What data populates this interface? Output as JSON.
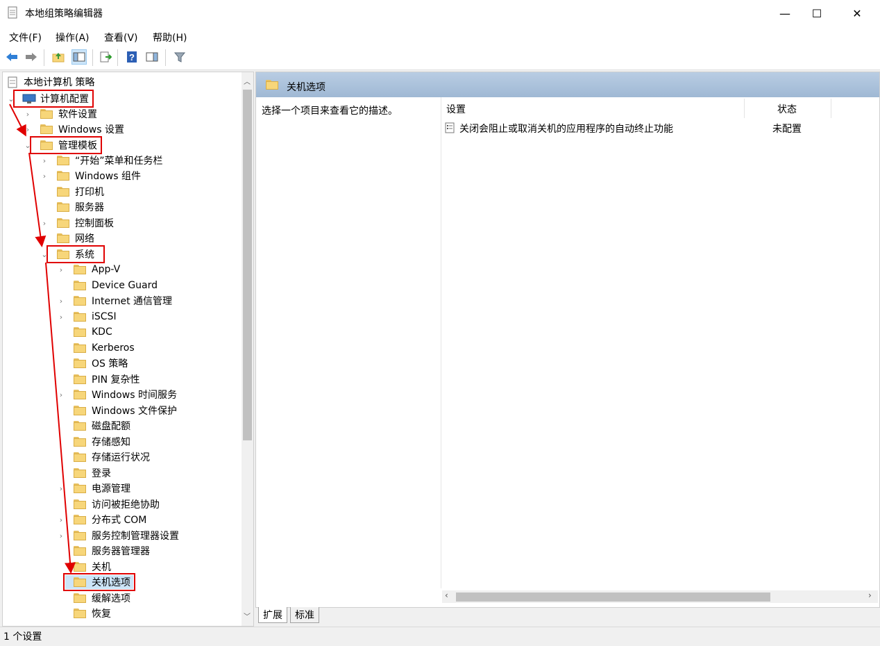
{
  "window": {
    "title": "本地组策略编辑器",
    "minimize": "—",
    "maximize": "☐",
    "close": "✕"
  },
  "menu": [
    "文件(F)",
    "操作(A)",
    "查看(V)",
    "帮助(H)"
  ],
  "tree": {
    "root": "本地计算机 策略",
    "computer_config": "计算机配置",
    "software": "软件设置",
    "windows_settings": "Windows 设置",
    "admin_templates": "管理模板",
    "admin_children": [
      "“开始”菜单和任务栏",
      "Windows 组件",
      "打印机",
      "服务器",
      "控制面板",
      "网络"
    ],
    "system": "系统",
    "system_children": [
      "App-V",
      "Device Guard",
      "Internet 通信管理",
      "iSCSI",
      "KDC",
      "Kerberos",
      "OS 策略",
      "PIN 复杂性",
      "Windows 时间服务",
      "Windows 文件保护",
      "磁盘配额",
      "存储感知",
      "存储运行状况",
      "登录",
      "电源管理",
      "访问被拒绝协助",
      "分布式 COM",
      "服务控制管理器设置",
      "服务器管理器",
      "关机",
      "关机选项",
      "缓解选项",
      "恢复"
    ]
  },
  "right": {
    "header": "关机选项",
    "description": "选择一个项目来查看它的描述。",
    "col_setting": "设置",
    "col_state": "状态",
    "rows": [
      {
        "setting": "关闭会阻止或取消关机的应用程序的自动终止功能",
        "state": "未配置"
      }
    ]
  },
  "tabs": [
    "扩展",
    "标准"
  ],
  "status": "1 个设置",
  "colors": {
    "highlight_box": "#e00000",
    "header_gradient": "#9fb8d4"
  }
}
